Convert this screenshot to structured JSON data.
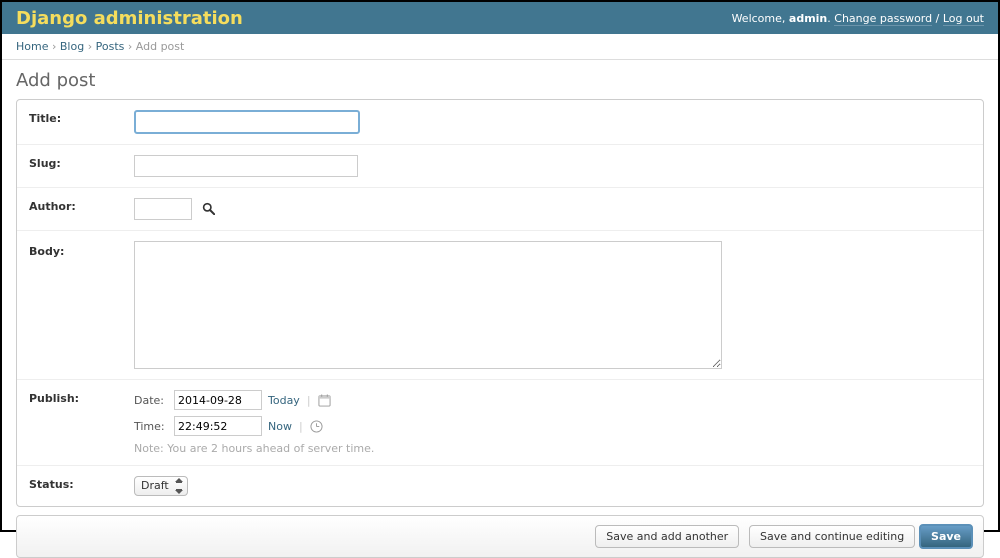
{
  "header": {
    "branding": "Django administration",
    "welcome_prefix": "Welcome,",
    "username": "admin",
    "change_password": "Change password",
    "logout": "Log out"
  },
  "breadcrumbs": {
    "home": "Home",
    "app": "Blog",
    "model": "Posts",
    "current": "Add post"
  },
  "page_title": "Add post",
  "form": {
    "title": {
      "label": "Title:",
      "value": ""
    },
    "slug": {
      "label": "Slug:",
      "value": ""
    },
    "author": {
      "label": "Author:",
      "value": ""
    },
    "body": {
      "label": "Body:",
      "value": ""
    },
    "publish": {
      "label": "Publish:",
      "date_label": "Date:",
      "date_value": "2014-09-28",
      "today_link": "Today",
      "time_label": "Time:",
      "time_value": "22:49:52",
      "now_link": "Now",
      "tz_note": "Note: You are 2 hours ahead of server time."
    },
    "status": {
      "label": "Status:",
      "selected": "Draft"
    }
  },
  "buttons": {
    "save_add_another": "Save and add another",
    "save_continue": "Save and continue editing",
    "save": "Save"
  }
}
